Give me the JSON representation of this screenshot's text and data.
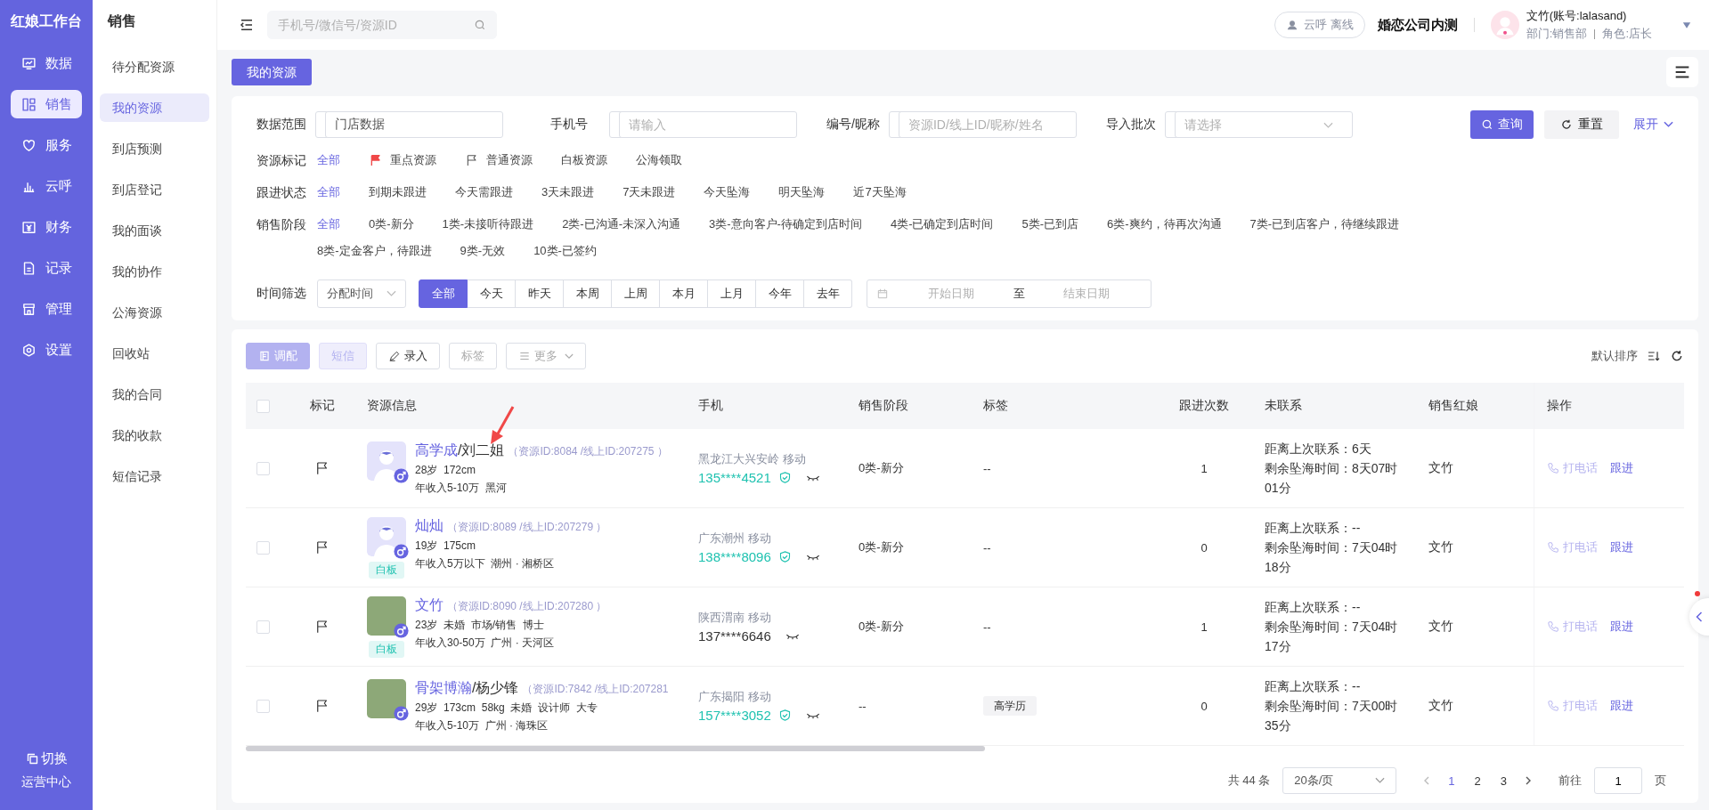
{
  "rail": {
    "title": "红娘工作台",
    "items": [
      {
        "label": "数据",
        "selected": false
      },
      {
        "label": "销售",
        "selected": true
      },
      {
        "label": "服务",
        "selected": false
      },
      {
        "label": "云呼",
        "selected": false
      },
      {
        "label": "财务",
        "selected": false
      },
      {
        "label": "记录",
        "selected": false
      },
      {
        "label": "管理",
        "selected": false
      },
      {
        "label": "设置",
        "selected": false
      }
    ],
    "switch": {
      "label": "切换",
      "sub": "运营中心"
    }
  },
  "sidebar": {
    "title": "销售",
    "items": [
      {
        "label": "待分配资源",
        "selected": false
      },
      {
        "label": "我的资源",
        "selected": true
      },
      {
        "label": "到店预测",
        "selected": false
      },
      {
        "label": "到店登记",
        "selected": false
      },
      {
        "label": "我的面谈",
        "selected": false
      },
      {
        "label": "我的协作",
        "selected": false
      },
      {
        "label": "公海资源",
        "selected": false
      },
      {
        "label": "回收站",
        "selected": false
      },
      {
        "label": "我的合同",
        "selected": false
      },
      {
        "label": "我的收款",
        "selected": false
      },
      {
        "label": "短信记录",
        "selected": false
      }
    ]
  },
  "header": {
    "search": {
      "placeholder": "手机号/微信号/资源ID"
    },
    "call_status": "云呼 离线",
    "company": "婚恋公司内测",
    "user": {
      "name": "文竹(账号:lalasand)",
      "department": "部门:销售部",
      "role": "角色:店长"
    }
  },
  "tabs": [
    {
      "label": "我的资源",
      "selected": true
    }
  ],
  "filters": {
    "fields": [
      {
        "label": "数据范围",
        "kind": "input",
        "value": "门店数据"
      },
      {
        "label": "手机号",
        "kind": "input",
        "placeholder": "请输入"
      },
      {
        "label": "编号/昵称",
        "kind": "input",
        "placeholder": "资源ID/线上ID/昵称/姓名"
      },
      {
        "label": "导入批次",
        "kind": "select",
        "placeholder": "请选择"
      }
    ],
    "search_button": "查询",
    "reset_button": "重置",
    "expand_link": "展开",
    "option_rows": [
      {
        "label": "资源标记",
        "options": [
          {
            "label": "全部",
            "selected": true
          },
          {
            "label": "重点资源",
            "selected": false
          },
          {
            "label": "普通资源",
            "selected": false
          },
          {
            "label": "白板资源",
            "selected": false
          },
          {
            "label": "公海领取",
            "selected": false
          }
        ]
      },
      {
        "label": "跟进状态",
        "options": [
          {
            "label": "全部",
            "selected": true
          },
          {
            "label": "到期未跟进",
            "selected": false
          },
          {
            "label": "今天需跟进",
            "selected": false
          },
          {
            "label": "3天未跟进",
            "selected": false
          },
          {
            "label": "7天未跟进",
            "selected": false
          },
          {
            "label": "今天坠海",
            "selected": false
          },
          {
            "label": "明天坠海",
            "selected": false
          },
          {
            "label": "近7天坠海",
            "selected": false
          }
        ]
      },
      {
        "label": "销售阶段",
        "options": [
          {
            "label": "全部",
            "selected": true
          },
          {
            "label": "0类-新分",
            "selected": false
          },
          {
            "label": "1类-未接听待跟进",
            "selected": false
          },
          {
            "label": "2类-已沟通-未深入沟通",
            "selected": false
          },
          {
            "label": "3类-意向客户-待确定到店时间",
            "selected": false
          },
          {
            "label": "4类-已确定到店时间",
            "selected": false
          },
          {
            "label": "5类-已到店",
            "selected": false
          },
          {
            "label": "6类-爽约，待再次沟通",
            "selected": false
          },
          {
            "label": "7类-已到店客户，待继续跟进",
            "selected": false
          },
          {
            "label": "8类-定金客户，待跟进",
            "selected": false
          },
          {
            "label": "9类-无效",
            "selected": false
          },
          {
            "label": "10类-已签约",
            "selected": false
          }
        ]
      }
    ],
    "time": {
      "label": "时间筛选",
      "select_value": "分配时间",
      "segments": [
        {
          "label": "全部",
          "selected": true
        },
        {
          "label": "今天",
          "selected": false
        },
        {
          "label": "昨天",
          "selected": false
        },
        {
          "label": "本周",
          "selected": false
        },
        {
          "label": "上周",
          "selected": false
        },
        {
          "label": "本月",
          "selected": false
        },
        {
          "label": "上月",
          "selected": false
        },
        {
          "label": "今年",
          "selected": false
        },
        {
          "label": "去年",
          "selected": false
        }
      ],
      "start_placeholder": "开始日期",
      "separator": "至",
      "end_placeholder": "结束日期"
    }
  },
  "toolbar": {
    "buttons": [
      {
        "label": "调配",
        "kind": "primary",
        "disabled": true
      },
      {
        "label": "短信",
        "kind": "soft",
        "disabled": true
      },
      {
        "label": "录入",
        "kind": "plain",
        "disabled": false
      },
      {
        "label": "标签",
        "kind": "plain",
        "disabled": true
      },
      {
        "label": "更多",
        "kind": "plain",
        "disabled": true
      }
    ],
    "sort_label": "默认排序"
  },
  "table": {
    "select_all_checked": false,
    "columns": [
      "标记",
      "资源信息",
      "手机",
      "销售阶段",
      "标签",
      "跟进次数",
      "未联系",
      "销售红娘",
      "操作"
    ],
    "rows": [
      {
        "checked": false,
        "avatar": {
          "kind": "cartoon"
        },
        "name": "高学成",
        "alias": "/刘二姐",
        "ids": "（资源ID:8084 /线上ID:207275 ）",
        "details": "28岁  172cm",
        "income": "年收入5-10万  黑河",
        "location": "黑龙江大兴安岭 移动",
        "phone": "135****4521",
        "verified": true,
        "stage": "0类-新分",
        "tag": {
          "kind": "empty",
          "text": "--"
        },
        "follow_count": "1",
        "last_contact": "距离上次联系：6天",
        "remaining": "剩余坠海时间：8天07时01分",
        "matchmaker": "文竹",
        "call": "打电话",
        "follow": "跟进"
      },
      {
        "checked": false,
        "avatar": {
          "kind": "cartoon"
        },
        "badge": "白板",
        "name": "灿灿",
        "ids": "（资源ID:8089 /线上ID:207279 ）",
        "details": "19岁  175cm",
        "income": "年收入5万以下  潮州 · 湘桥区",
        "location": "广东潮州 移动",
        "phone": "138****8096",
        "verified": true,
        "stage": "0类-新分",
        "tag": {
          "kind": "empty",
          "text": "--"
        },
        "follow_count": "0",
        "last_contact": "距离上次联系：--",
        "remaining": "剩余坠海时间：7天04时18分",
        "matchmaker": "文竹",
        "call": "打电话",
        "follow": "跟进"
      },
      {
        "checked": false,
        "avatar": {
          "kind": "photo"
        },
        "badge": "白板",
        "name": "文竹",
        "ids": "（资源ID:8090 /线上ID:207280 ）",
        "details": "23岁  未婚  市场/销售  博士",
        "income": "年收入30-50万  广州 · 天河区",
        "location": "陕西渭南 移动",
        "phone": "137****6646",
        "verified": false,
        "stage": "0类-新分",
        "tag": {
          "kind": "empty",
          "text": "--"
        },
        "follow_count": "1",
        "last_contact": "距离上次联系：--",
        "remaining": "剩余坠海时间：7天04时17分",
        "matchmaker": "文竹",
        "call": "打电话",
        "follow": "跟进"
      },
      {
        "checked": false,
        "avatar": {
          "kind": "photo"
        },
        "name": "骨架博瀚",
        "alias": "/杨少锋",
        "ids": "（资源ID:7842 /线上ID:207281",
        "details": "29岁  173cm  58kg  未婚  设计师  大专",
        "income": "年收入5-10万  广州 · 海珠区",
        "location": "广东揭阳 移动",
        "phone": "157****3052",
        "verified": true,
        "stage": "--",
        "tag": {
          "kind": "chip",
          "text": "高学历"
        },
        "follow_count": "0",
        "last_contact": "距离上次联系：--",
        "remaining": "剩余坠海时间：7天00时35分",
        "matchmaker": "文竹",
        "call": "打电话",
        "follow": "跟进"
      }
    ]
  },
  "pagination": {
    "total": "共 44 条",
    "page_size": "20条/页",
    "pages": [
      {
        "label": "1",
        "selected": true
      },
      {
        "label": "2",
        "selected": false
      },
      {
        "label": "3",
        "selected": false
      }
    ],
    "goto_label": "前往",
    "goto_value": "1",
    "goto_unit": "页"
  }
}
